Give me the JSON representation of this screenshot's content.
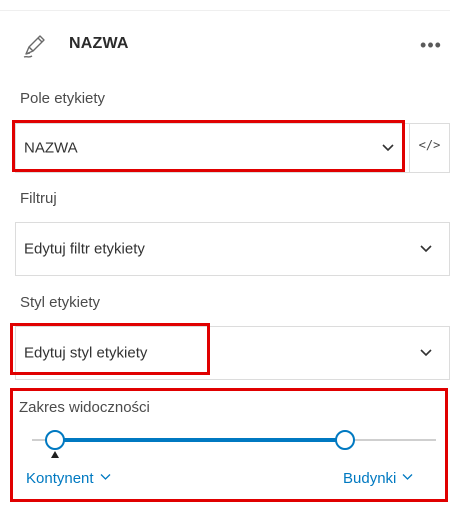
{
  "header": {
    "title": "NAZWA",
    "more_glyph": "•••",
    "icon": "edit-pen-icon"
  },
  "label_field": {
    "label": "Pole etykiety",
    "value": "NAZWA",
    "code_glyph": "</>"
  },
  "filter": {
    "label": "Filtruj",
    "value": "Edytuj filtr etykiety"
  },
  "style": {
    "label": "Styl etykiety",
    "value": "Edytuj styl etykiety"
  },
  "visibility": {
    "label": "Zakres widoczności",
    "min_label": "Kontynent",
    "max_label": "Budynki"
  },
  "colors": {
    "accent": "#0079c1",
    "highlight": "#e00000"
  }
}
